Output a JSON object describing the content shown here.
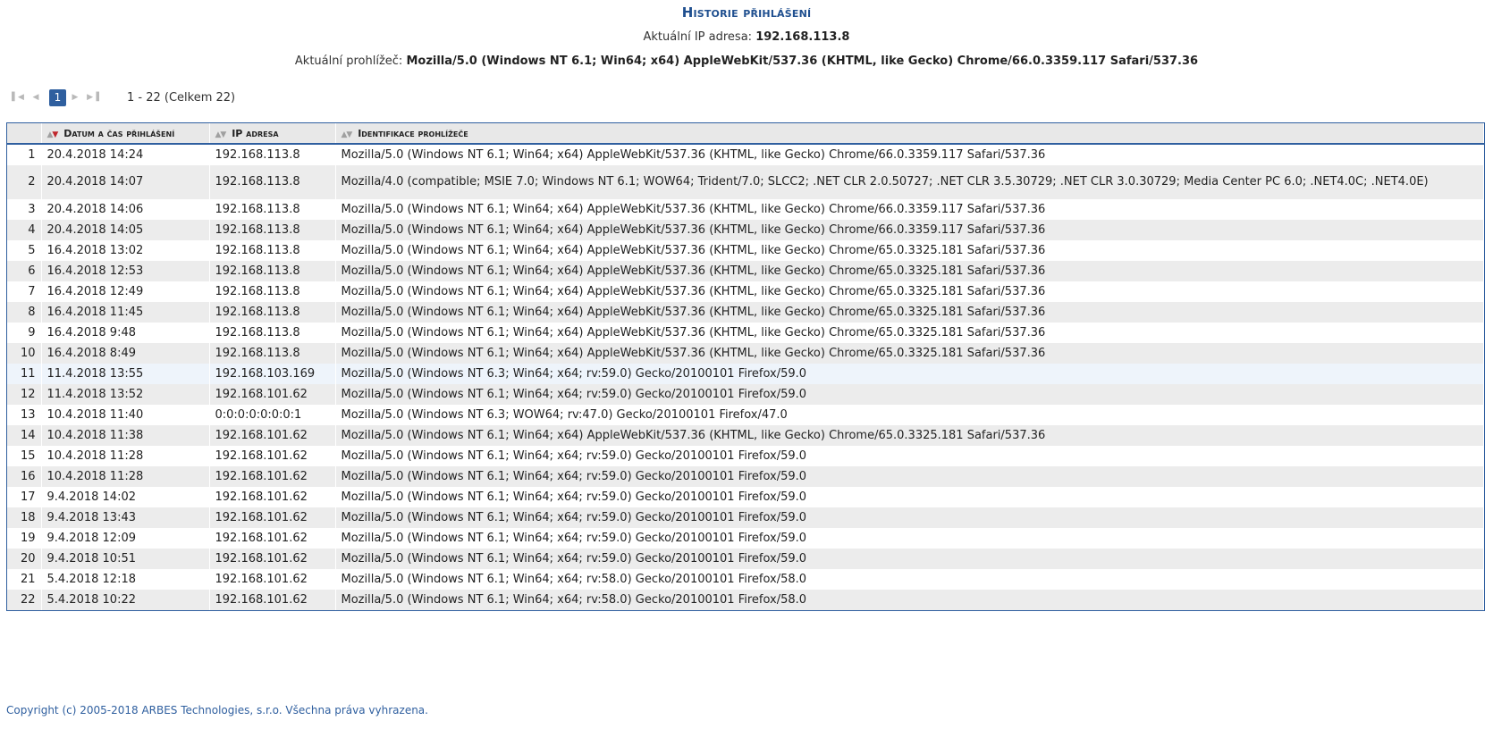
{
  "title": "Historie přihlášení",
  "ip_label": "Aktuální IP adresa:",
  "ip_value": "192.168.113.8",
  "browser_label": "Aktuální prohlížeč:",
  "browser_value": "Mozilla/5.0 (Windows NT 6.1; Win64; x64) AppleWebKit/537.36 (KHTML, like Gecko) Chrome/66.0.3359.117 Safari/537.36",
  "pager": {
    "current_page": "1",
    "info": "1 - 22 (Celkem 22)"
  },
  "columns": [
    "",
    "Datum a čas přihlášení",
    "IP adresa",
    "Identifikace prohlížeče"
  ],
  "rows": [
    {
      "n": "1",
      "date": "20.4.2018 14:24",
      "ip": "192.168.113.8",
      "ua": "Mozilla/5.0 (Windows NT 6.1; Win64; x64) AppleWebKit/537.36 (KHTML, like Gecko) Chrome/66.0.3359.117 Safari/537.36"
    },
    {
      "n": "2",
      "date": "20.4.2018 14:07",
      "ip": "192.168.113.8",
      "ua": "Mozilla/4.0 (compatible; MSIE 7.0; Windows NT 6.1; WOW64; Trident/7.0; SLCC2; .NET CLR 2.0.50727; .NET CLR 3.5.30729; .NET CLR 3.0.30729; Media Center PC 6.0; .NET4.0C; .NET4.0E)"
    },
    {
      "n": "3",
      "date": "20.4.2018 14:06",
      "ip": "192.168.113.8",
      "ua": "Mozilla/5.0 (Windows NT 6.1; Win64; x64) AppleWebKit/537.36 (KHTML, like Gecko) Chrome/66.0.3359.117 Safari/537.36"
    },
    {
      "n": "4",
      "date": "20.4.2018 14:05",
      "ip": "192.168.113.8",
      "ua": "Mozilla/5.0 (Windows NT 6.1; Win64; x64) AppleWebKit/537.36 (KHTML, like Gecko) Chrome/66.0.3359.117 Safari/537.36"
    },
    {
      "n": "5",
      "date": "16.4.2018 13:02",
      "ip": "192.168.113.8",
      "ua": "Mozilla/5.0 (Windows NT 6.1; Win64; x64) AppleWebKit/537.36 (KHTML, like Gecko) Chrome/65.0.3325.181 Safari/537.36"
    },
    {
      "n": "6",
      "date": "16.4.2018 12:53",
      "ip": "192.168.113.8",
      "ua": "Mozilla/5.0 (Windows NT 6.1; Win64; x64) AppleWebKit/537.36 (KHTML, like Gecko) Chrome/65.0.3325.181 Safari/537.36"
    },
    {
      "n": "7",
      "date": "16.4.2018 12:49",
      "ip": "192.168.113.8",
      "ua": "Mozilla/5.0 (Windows NT 6.1; Win64; x64) AppleWebKit/537.36 (KHTML, like Gecko) Chrome/65.0.3325.181 Safari/537.36"
    },
    {
      "n": "8",
      "date": "16.4.2018 11:45",
      "ip": "192.168.113.8",
      "ua": "Mozilla/5.0 (Windows NT 6.1; Win64; x64) AppleWebKit/537.36 (KHTML, like Gecko) Chrome/65.0.3325.181 Safari/537.36"
    },
    {
      "n": "9",
      "date": "16.4.2018 9:48",
      "ip": "192.168.113.8",
      "ua": "Mozilla/5.0 (Windows NT 6.1; Win64; x64) AppleWebKit/537.36 (KHTML, like Gecko) Chrome/65.0.3325.181 Safari/537.36"
    },
    {
      "n": "10",
      "date": "16.4.2018 8:49",
      "ip": "192.168.113.8",
      "ua": "Mozilla/5.0 (Windows NT 6.1; Win64; x64) AppleWebKit/537.36 (KHTML, like Gecko) Chrome/65.0.3325.181 Safari/537.36"
    },
    {
      "n": "11",
      "date": "11.4.2018 13:55",
      "ip": "192.168.103.169",
      "ua": "Mozilla/5.0 (Windows NT 6.3; Win64; x64; rv:59.0) Gecko/20100101 Firefox/59.0"
    },
    {
      "n": "12",
      "date": "11.4.2018 13:52",
      "ip": "192.168.101.62",
      "ua": "Mozilla/5.0 (Windows NT 6.1; Win64; x64; rv:59.0) Gecko/20100101 Firefox/59.0"
    },
    {
      "n": "13",
      "date": "10.4.2018 11:40",
      "ip": "0:0:0:0:0:0:0:1",
      "ua": "Mozilla/5.0 (Windows NT 6.3; WOW64; rv:47.0) Gecko/20100101 Firefox/47.0"
    },
    {
      "n": "14",
      "date": "10.4.2018 11:38",
      "ip": "192.168.101.62",
      "ua": "Mozilla/5.0 (Windows NT 6.1; Win64; x64) AppleWebKit/537.36 (KHTML, like Gecko) Chrome/65.0.3325.181 Safari/537.36"
    },
    {
      "n": "15",
      "date": "10.4.2018 11:28",
      "ip": "192.168.101.62",
      "ua": "Mozilla/5.0 (Windows NT 6.1; Win64; x64; rv:59.0) Gecko/20100101 Firefox/59.0"
    },
    {
      "n": "16",
      "date": "10.4.2018 11:28",
      "ip": "192.168.101.62",
      "ua": "Mozilla/5.0 (Windows NT 6.1; Win64; x64; rv:59.0) Gecko/20100101 Firefox/59.0"
    },
    {
      "n": "17",
      "date": "9.4.2018 14:02",
      "ip": "192.168.101.62",
      "ua": "Mozilla/5.0 (Windows NT 6.1; Win64; x64; rv:59.0) Gecko/20100101 Firefox/59.0"
    },
    {
      "n": "18",
      "date": "9.4.2018 13:43",
      "ip": "192.168.101.62",
      "ua": "Mozilla/5.0 (Windows NT 6.1; Win64; x64; rv:59.0) Gecko/20100101 Firefox/59.0"
    },
    {
      "n": "19",
      "date": "9.4.2018 12:09",
      "ip": "192.168.101.62",
      "ua": "Mozilla/5.0 (Windows NT 6.1; Win64; x64; rv:59.0) Gecko/20100101 Firefox/59.0"
    },
    {
      "n": "20",
      "date": "9.4.2018 10:51",
      "ip": "192.168.101.62",
      "ua": "Mozilla/5.0 (Windows NT 6.1; Win64; x64; rv:59.0) Gecko/20100101 Firefox/59.0"
    },
    {
      "n": "21",
      "date": "5.4.2018 12:18",
      "ip": "192.168.101.62",
      "ua": "Mozilla/5.0 (Windows NT 6.1; Win64; x64; rv:58.0) Gecko/20100101 Firefox/58.0"
    },
    {
      "n": "22",
      "date": "5.4.2018 10:22",
      "ip": "192.168.101.62",
      "ua": "Mozilla/5.0 (Windows NT 6.1; Win64; x64; rv:58.0) Gecko/20100101 Firefox/58.0"
    }
  ],
  "footer": "Copyright (c) 2005-2018 ARBES Technologies, s.r.o. Všechna práva vyhrazena.",
  "colors": {
    "accent": "#2f5f9f",
    "title": "#1f4f8f",
    "sort_active": "#c0272d"
  }
}
